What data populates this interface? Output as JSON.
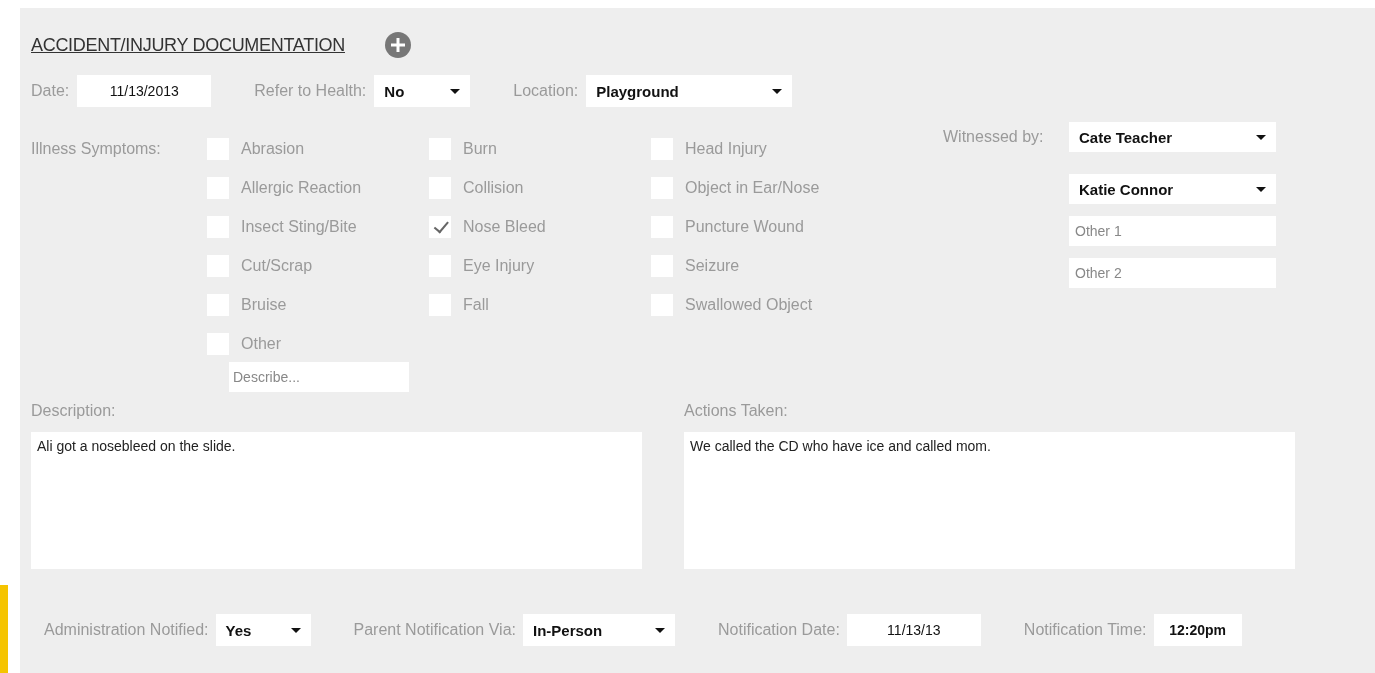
{
  "title": "ACCIDENT/INJURY DOCUMENTATION",
  "top_fields": [
    {
      "kind": "input",
      "label": "Date:",
      "value": "11/13/2013"
    },
    {
      "kind": "select",
      "label": "Refer to Health:",
      "value": "No"
    },
    {
      "kind": "select",
      "label": "Location:",
      "value": "Playground"
    }
  ],
  "symptoms": {
    "label": "Illness Symptoms:",
    "columns": [
      [
        {
          "label": "Abrasion",
          "checked": false
        },
        {
          "label": "Allergic Reaction",
          "checked": false
        },
        {
          "label": "Insect Sting/Bite",
          "checked": false
        },
        {
          "label": "Cut/Scrap",
          "checked": false
        },
        {
          "label": "Bruise",
          "checked": false
        },
        {
          "label": "Other",
          "checked": false
        }
      ],
      [
        {
          "label": "Burn",
          "checked": false
        },
        {
          "label": "Collision",
          "checked": false
        },
        {
          "label": "Nose Bleed",
          "checked": true
        },
        {
          "label": "Eye Injury",
          "checked": false
        },
        {
          "label": "Fall",
          "checked": false
        }
      ],
      [
        {
          "label": "Head Injury",
          "checked": false
        },
        {
          "label": "Object in Ear/Nose",
          "checked": false
        },
        {
          "label": "Puncture Wound",
          "checked": false
        },
        {
          "label": "Seizure",
          "checked": false
        },
        {
          "label": "Swallowed Object",
          "checked": false
        }
      ]
    ],
    "describe_placeholder": "Describe..."
  },
  "witnessed": {
    "label": "Witnessed by:",
    "fields": [
      {
        "kind": "select",
        "value": "Cate Teacher"
      },
      {
        "kind": "select",
        "value": "Katie Connor"
      },
      {
        "kind": "input",
        "placeholder": "Other 1"
      },
      {
        "kind": "input",
        "placeholder": "Other 2"
      }
    ]
  },
  "text_areas": [
    {
      "label": "Description:",
      "value": "Ali got a nosebleed on the slide."
    },
    {
      "label": "Actions Taken:",
      "value": "We called the CD who have ice and called mom."
    }
  ],
  "bottom_fields": [
    {
      "kind": "select",
      "label": "Administration Notified:",
      "value": "Yes"
    },
    {
      "kind": "select",
      "label": "Parent Notification Via:",
      "value": "In-Person"
    },
    {
      "kind": "input",
      "label": "Notification Date:",
      "value": "11/13/13"
    },
    {
      "kind": "input",
      "label": "Notification Time:",
      "value": "12:20pm"
    }
  ]
}
